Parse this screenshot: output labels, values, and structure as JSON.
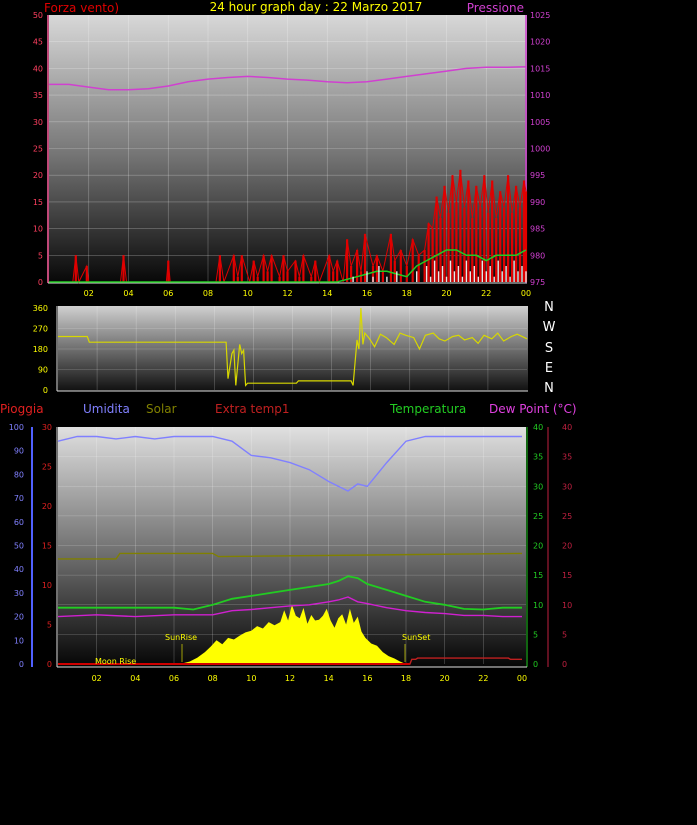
{
  "header": {
    "left_title": "Forza vento)",
    "center_title": "24 hour graph day : 22 Marzo 2017",
    "right_title": "Pressione"
  },
  "colors": {
    "wind": "#e00000",
    "wind_avg": "#22cc22",
    "gust_white": "#e8e8e8",
    "pressure": "#d040d0",
    "direction": "#d8d800",
    "humidity": "#8080ff",
    "solar": "#808000",
    "extra_temp": "#c02020",
    "temperature": "#22cc22",
    "dew_point": "#d020d0",
    "rain": "#d00000",
    "sun_area": "#ffff00",
    "axis_left_bottom": "#5060ff"
  },
  "compass": [
    "N",
    "W",
    "S",
    "E",
    "N"
  ],
  "legend_bottom": {
    "rain": "Pioggia",
    "humidity": "Umidita",
    "solar": "Solar",
    "extra_temp": "Extra temp1",
    "temperature": "Temperatura",
    "dew_point": "Dew Point (°C)"
  },
  "annotations": {
    "moon_rise": "Moon Rise",
    "sun_rise": "SunRise",
    "sun_set": "SunSet"
  },
  "chart_data": [
    {
      "id": "wind_pressure",
      "type": "line",
      "x_ticks": [
        "02",
        "04",
        "06",
        "08",
        "10",
        "12",
        "14",
        "16",
        "18",
        "20",
        "22",
        "00"
      ],
      "y_left_ticks": [
        "0",
        "5",
        "10",
        "15",
        "20",
        "25",
        "30",
        "35",
        "40",
        "45",
        "50"
      ],
      "y_left_lim": [
        0,
        50
      ],
      "y_right_ticks": [
        "975",
        "980",
        "985",
        "990",
        "995",
        "1000",
        "1005",
        "1010",
        "1015",
        "1020",
        "1025"
      ],
      "y_right_lim": [
        975,
        1025
      ],
      "series": [
        {
          "key": "pressure",
          "axis": "right",
          "x": [
            0,
            1,
            2,
            3,
            4,
            5,
            6,
            7,
            8,
            9,
            10,
            11,
            12,
            13,
            14,
            15,
            16,
            17,
            18,
            19,
            20,
            21,
            22,
            23,
            24
          ],
          "values": [
            1012,
            1012,
            1011.5,
            1011,
            1011,
            1011.2,
            1011.7,
            1012.5,
            1013,
            1013.3,
            1013.5,
            1013.3,
            1013,
            1012.8,
            1012.5,
            1012.3,
            1012.5,
            1013,
            1013.5,
            1014,
            1014.5,
            1015,
            1015.2,
            1015.2,
            1015.3
          ]
        },
        {
          "key": "wind",
          "x": [
            0,
            1.2,
            1.35,
            1.5,
            1.9,
            2,
            3.6,
            3.75,
            3.9,
            5.9,
            6,
            6.1,
            8.4,
            8.6,
            8.8,
            9.3,
            9.5,
            9.7,
            10.1,
            10.3,
            10.5,
            10.8,
            11,
            11.2,
            11.6,
            11.8,
            12,
            12.4,
            12.6,
            12.8,
            13.2,
            13.4,
            13.6,
            14.1,
            14.3,
            14.5,
            14.8,
            15,
            15.2,
            15.5,
            15.7,
            15.9,
            16.3,
            16.5,
            16.8,
            17.2,
            17.4,
            17.7,
            18,
            18.3,
            18.6,
            18.9,
            19.1,
            19.3,
            19.5,
            19.7,
            19.9,
            20.1,
            20.3,
            20.5,
            20.7,
            20.9,
            21.1,
            21.3,
            21.5,
            21.7,
            21.9,
            22.1,
            22.3,
            22.5,
            22.7,
            22.9,
            23.1,
            23.3,
            23.5,
            23.7,
            23.9,
            24
          ],
          "values": [
            0,
            0,
            5,
            0,
            3,
            0,
            0,
            5,
            0,
            0,
            4,
            0,
            0,
            5,
            0,
            5,
            1,
            5,
            0,
            4,
            1,
            5,
            2,
            5,
            1,
            5,
            2,
            4,
            1,
            5,
            1,
            4,
            0,
            5,
            2,
            4,
            0,
            8,
            3,
            6,
            2,
            9,
            3,
            5,
            2,
            9,
            4,
            6,
            3,
            8,
            5,
            6,
            11,
            10,
            16,
            12,
            18,
            13,
            20,
            15,
            21,
            14,
            19,
            12,
            18,
            14,
            20,
            13,
            19,
            12,
            17,
            14,
            20,
            13,
            18,
            14,
            19,
            17
          ]
        },
        {
          "key": "wind_avg",
          "x": [
            0,
            14.5,
            15,
            15.5,
            16,
            16.5,
            17,
            17.5,
            18,
            18.5,
            19,
            19.5,
            20,
            20.5,
            21,
            21.5,
            22,
            22.5,
            23,
            23.5,
            24
          ],
          "values": [
            0,
            0,
            0.5,
            1,
            1.5,
            2,
            2,
            1.5,
            1,
            3,
            4,
            5,
            6,
            6,
            5,
            5,
            4,
            5,
            5,
            5,
            6
          ]
        },
        {
          "key": "gust_white",
          "x": [
            15,
            15.3,
            15.6,
            16,
            16.3,
            16.6,
            17,
            17.5,
            18,
            18.5,
            19,
            19.2,
            19.4,
            19.6,
            19.8,
            20,
            20.2,
            20.4,
            20.6,
            20.8,
            21,
            21.2,
            21.4,
            21.6,
            21.8,
            22,
            22.2,
            22.4,
            22.6,
            22.8,
            23,
            23.2,
            23.4,
            23.6,
            23.8,
            24
          ],
          "values": [
            0,
            1,
            0,
            2,
            1,
            3,
            1,
            2,
            0,
            2,
            3,
            1,
            4,
            2,
            3,
            1,
            4,
            2,
            3,
            1,
            4,
            2,
            3,
            1,
            4,
            2,
            3,
            1,
            4,
            2,
            3,
            1,
            4,
            2,
            3,
            2
          ]
        }
      ]
    },
    {
      "id": "wind_direction",
      "type": "line",
      "y_ticks": [
        "0",
        "90",
        "180",
        "270",
        "360"
      ],
      "y_lim": [
        0,
        360
      ],
      "series": [
        {
          "key": "direction",
          "x": [
            0,
            1.5,
            1.6,
            8.6,
            8.7,
            8.9,
            9.0,
            9.1,
            9.3,
            9.4,
            9.5,
            9.6,
            9.7,
            12.2,
            12.3,
            15,
            15.1,
            15.3,
            15.4,
            15.5,
            15.6,
            15.7,
            15.9,
            16.2,
            16.5,
            16.8,
            17.2,
            17.5,
            17.8,
            18.2,
            18.5,
            18.8,
            19.2,
            19.5,
            19.8,
            20.2,
            20.5,
            20.8,
            21.2,
            21.5,
            21.8,
            22.2,
            22.5,
            22.8,
            23.2,
            23.5,
            24
          ],
          "values": [
            235,
            235,
            210,
            210,
            50,
            160,
            175,
            20,
            200,
            160,
            175,
            20,
            30,
            30,
            40,
            40,
            20,
            220,
            180,
            360,
            200,
            250,
            230,
            190,
            245,
            230,
            200,
            250,
            240,
            230,
            180,
            240,
            250,
            225,
            215,
            235,
            240,
            220,
            230,
            205,
            240,
            225,
            250,
            215,
            235,
            245,
            225
          ]
        }
      ]
    },
    {
      "id": "temp_humidity",
      "type": "line",
      "x_ticks": [
        "02",
        "04",
        "06",
        "08",
        "10",
        "12",
        "14",
        "16",
        "18",
        "20",
        "22",
        "00"
      ],
      "y_pioggia_ticks": [
        "0",
        "10",
        "20",
        "30",
        "40",
        "50",
        "60",
        "70",
        "80",
        "90",
        "100"
      ],
      "y_pioggia_lim": [
        0,
        100
      ],
      "y_solar_ticks": [
        "0",
        "5",
        "10",
        "15",
        "20",
        "25",
        "30"
      ],
      "y_solar_lim": [
        0,
        30
      ],
      "y_temp_ticks": [
        "0",
        "5",
        "10",
        "15",
        "20",
        "25",
        "30",
        "35",
        "40"
      ],
      "y_temp_lim": [
        0,
        40
      ],
      "y_dew_ticks": [
        "0",
        "5",
        "10",
        "15",
        "20",
        "25",
        "30",
        "35",
        "40"
      ],
      "y_dew_lim": [
        0,
        40
      ],
      "series": [
        {
          "key": "humidity",
          "axis": "pioggia",
          "x": [
            0,
            1,
            2,
            3,
            4,
            5,
            6,
            7,
            8,
            9,
            10,
            11,
            12,
            13,
            14,
            14.5,
            15,
            15.5,
            16,
            17,
            18,
            19,
            20,
            21,
            22,
            23,
            24
          ],
          "values": [
            94,
            96,
            96,
            95,
            96,
            95,
            96,
            96,
            96,
            94,
            88,
            87,
            85,
            82,
            77,
            75,
            73,
            76,
            75,
            85,
            94,
            96,
            96,
            96,
            96,
            96,
            96
          ]
        },
        {
          "key": "solar",
          "axis": "solar",
          "x": [
            0,
            3,
            3.2,
            8,
            8.3,
            24
          ],
          "values": [
            13.3,
            13.3,
            14,
            14,
            13.6,
            14
          ]
        },
        {
          "key": "temperature",
          "axis": "temp",
          "x": [
            0,
            2,
            4,
            6,
            7,
            8,
            9,
            10,
            11,
            12,
            13,
            14,
            14.5,
            15,
            15.5,
            16,
            17,
            18,
            19,
            20,
            21,
            22,
            23,
            24
          ],
          "values": [
            9.5,
            9.5,
            9.5,
            9.5,
            9.2,
            10,
            11,
            11.5,
            12,
            12.5,
            13,
            13.5,
            14,
            14.8,
            14.5,
            13.5,
            12.5,
            11.5,
            10.5,
            10,
            9.3,
            9.2,
            9.5,
            9.5
          ]
        },
        {
          "key": "dew_point",
          "axis": "dew",
          "x": [
            0,
            2,
            4,
            6,
            8,
            9,
            10,
            11,
            12,
            13,
            14,
            14.5,
            15,
            15.5,
            16,
            17,
            18,
            19,
            20,
            21,
            22,
            23,
            24
          ],
          "values": [
            8,
            8.3,
            8,
            8.3,
            8.3,
            9,
            9.2,
            9.5,
            9.8,
            10,
            10.5,
            10.8,
            11.3,
            10.5,
            10.2,
            9.5,
            9,
            8.7,
            8.5,
            8.2,
            8.2,
            8,
            8
          ]
        },
        {
          "key": "extra_temp",
          "axis": "temp",
          "x": [
            0,
            18.2,
            18.3,
            18.5,
            18.6,
            23.3,
            23.4,
            24
          ],
          "values": [
            0,
            0,
            0.8,
            0.8,
            1,
            1,
            0.8,
            0.8
          ]
        },
        {
          "key": "sun_area",
          "axis": "solar",
          "x": [
            6.3,
            6.8,
            7.2,
            7.6,
            7.9,
            8.2,
            8.5,
            8.8,
            9.1,
            9.4,
            9.7,
            10,
            10.3,
            10.6,
            10.9,
            11.2,
            11.5,
            11.7,
            11.9,
            12.1,
            12.3,
            12.5,
            12.7,
            12.9,
            13.1,
            13.3,
            13.5,
            13.7,
            13.9,
            14.1,
            14.3,
            14.5,
            14.7,
            14.9,
            15.1,
            15.3,
            15.5,
            15.7,
            15.9,
            16.2,
            16.5,
            16.8,
            17.1,
            17.4,
            17.7,
            18
          ],
          "values": [
            0,
            0.3,
            0.8,
            1.5,
            2.2,
            3,
            2.5,
            3.3,
            3.1,
            3.6,
            4,
            4.2,
            4.8,
            4.5,
            5.3,
            4.9,
            5.3,
            6.8,
            5.5,
            7.5,
            6.1,
            5.8,
            7.1,
            5.1,
            6.2,
            5.5,
            5.6,
            6.1,
            7,
            5.5,
            4.6,
            5.8,
            6.3,
            5,
            7,
            5.2,
            6,
            4.1,
            3.3,
            2.6,
            2.3,
            1.5,
            1,
            0.7,
            0.3,
            0
          ]
        }
      ]
    }
  ]
}
